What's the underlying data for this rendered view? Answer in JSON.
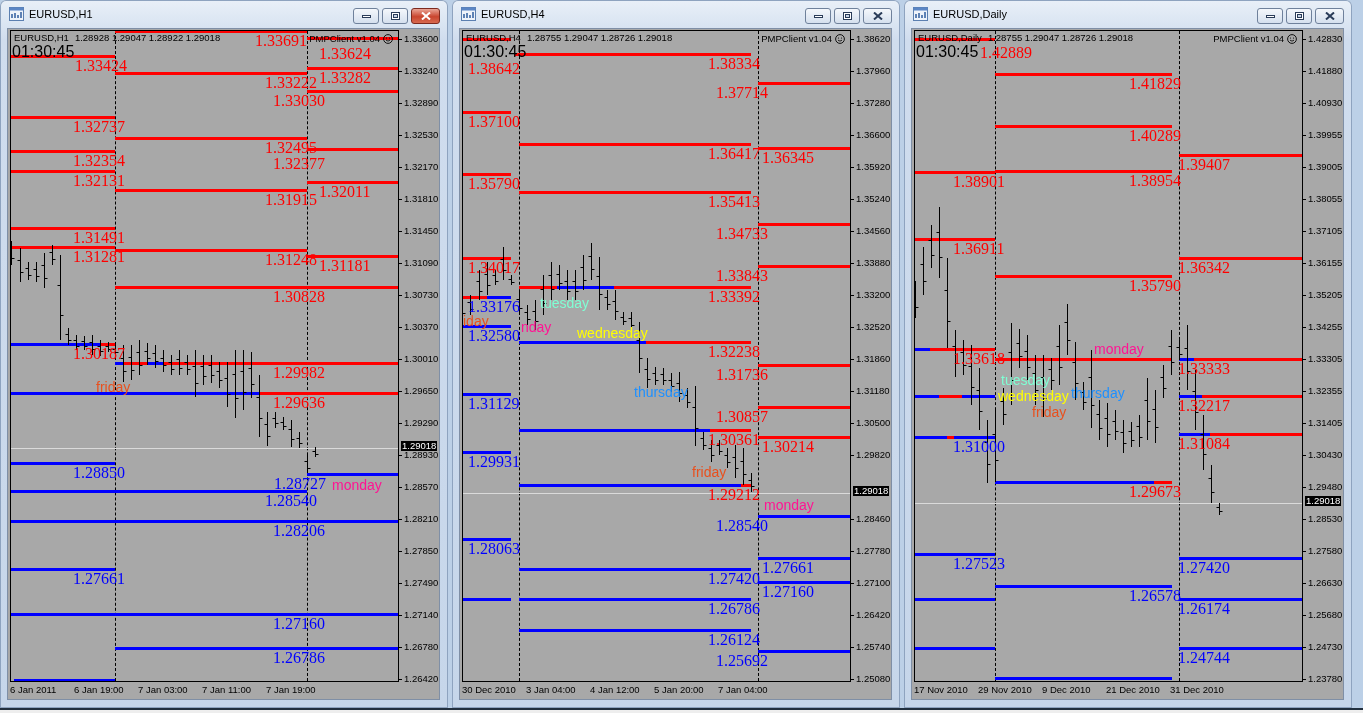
{
  "windows": [
    {
      "title": "EURUSD,H1",
      "active": true,
      "header": {
        "symbol": "EURUSD,H1",
        "prices": "1.28928 1.29047 1.28922 1.29018",
        "countdown": "01:30:45",
        "indicator": "PMPClient v1.04"
      },
      "price_axis": {
        "ticks": [
          "1.33600",
          "1.33240",
          "1.32890",
          "1.32530",
          "1.32170",
          "1.31810",
          "1.31450",
          "1.31090",
          "1.30730",
          "1.30370",
          "1.30010",
          "1.29650",
          "1.29290",
          "1.28930",
          "1.28570",
          "1.28210",
          "1.27850",
          "1.27490",
          "1.27140",
          "1.26780",
          "1.26420"
        ],
        "current": "1.29018"
      },
      "time_axis": [
        "6 Jan 2011",
        "6 Jan 19:00",
        "7 Jan 03:00",
        "7 Jan 11:00",
        "7 Jan 19:00"
      ],
      "levels": [
        {
          "label": "1.33691",
          "color": "#ff0000"
        },
        {
          "label": "1.33624",
          "color": "#ff0000"
        },
        {
          "label": "1.33424",
          "color": "#ff0000"
        },
        {
          "label": "1.33282",
          "color": "#ff0000"
        },
        {
          "label": "1.33222",
          "color": "#ff0000"
        },
        {
          "label": "1.33030",
          "color": "#ff0000"
        },
        {
          "label": "1.32737",
          "color": "#ff0000"
        },
        {
          "label": "1.32495",
          "color": "#ff0000"
        },
        {
          "label": "1.32377",
          "color": "#ff0000"
        },
        {
          "label": "1.32354",
          "color": "#ff0000"
        },
        {
          "label": "1.32131",
          "color": "#ff0000"
        },
        {
          "label": "1.32011",
          "color": "#ff0000"
        },
        {
          "label": "1.31915",
          "color": "#ff0000"
        },
        {
          "label": "1.31491",
          "color": "#ff0000"
        },
        {
          "label": "1.31281",
          "color": "#ff0000"
        },
        {
          "label": "1.31248",
          "color": "#ff0000"
        },
        {
          "label": "1.31181",
          "color": "#ff0000"
        },
        {
          "label": "1.30828",
          "color": "#ff0000"
        },
        {
          "label": "1.30187",
          "color": "#ff0000",
          "segments": [
            {
              "color": "#0000ff"
            },
            {
              "color": "#ff0000"
            }
          ]
        },
        {
          "label": "1.29982",
          "color": "#ff0000",
          "segments": [
            {
              "color": "#0000ff"
            },
            {
              "color": "#ff0000"
            },
            {
              "color": "#0000ff"
            },
            {
              "color": "#ff0000"
            }
          ]
        },
        {
          "label": "1.29636",
          "color": "#ff0000",
          "segments": [
            {
              "color": "#0000ff"
            },
            {
              "color": "#ff0000"
            }
          ]
        },
        {
          "label": "1.28850",
          "color": "#0000ff"
        },
        {
          "label": "1.28727",
          "color": "#0000ff"
        },
        {
          "label": "1.28540",
          "color": "#0000ff"
        },
        {
          "label": "1.28206",
          "color": "#0000ff"
        },
        {
          "label": "1.27661",
          "color": "#0000ff"
        },
        {
          "label": "1.27160",
          "color": "#0000ff"
        },
        {
          "label": "1.26786",
          "color": "#0000ff"
        },
        {
          "color": "#0000ff"
        }
      ],
      "day_labels": [
        {
          "label": "friday",
          "color": "#e8501e"
        },
        {
          "label": "monday",
          "color": "#ff1493"
        }
      ]
    },
    {
      "title": "EURUSD,H4",
      "active": false,
      "header": {
        "symbol": "EURUSD,H4",
        "prices": "1.28755 1.29047 1.28726 1.29018",
        "countdown": "01:30:45",
        "indicator": "PMPClient v1.04"
      },
      "price_axis": {
        "ticks": [
          "1.38620",
          "1.37960",
          "1.37280",
          "1.36600",
          "1.35920",
          "1.35240",
          "1.34560",
          "1.33880",
          "1.33200",
          "1.32520",
          "1.31860",
          "1.31180",
          "1.30500",
          "1.29820",
          "1.28460",
          "1.27780",
          "1.27100",
          "1.26420",
          "1.25740",
          "1.25080"
        ],
        "current": "1.29018"
      },
      "time_axis": [
        "30 Dec 2010",
        "3 Jan 04:00",
        "4 Jan 12:00",
        "5 Jan 20:00",
        "7 Jan 04:00"
      ],
      "levels": [
        {
          "label": "1.38642",
          "color": "#ff0000"
        },
        {
          "label": "1.38334",
          "color": "#ff0000"
        },
        {
          "label": "1.37714",
          "color": "#ff0000"
        },
        {
          "label": "1.37100",
          "color": "#ff0000"
        },
        {
          "label": "1.36417",
          "color": "#ff0000"
        },
        {
          "label": "1.36345",
          "color": "#ff0000"
        },
        {
          "label": "1.35790",
          "color": "#ff0000"
        },
        {
          "label": "1.35413",
          "color": "#ff0000"
        },
        {
          "label": "1.34733",
          "color": "#ff0000"
        },
        {
          "label": "1.34017",
          "color": "#ff0000"
        },
        {
          "label": "1.33843",
          "color": "#ff0000"
        },
        {
          "label": "1.33392",
          "color": "#ff0000",
          "segments": [
            {
              "color": "#ff0000"
            },
            {
              "color": "#0000ff"
            },
            {
              "color": "#ff0000"
            }
          ]
        },
        {
          "label": "1.33176",
          "color": "#0000ff",
          "segments": [
            {
              "color": "#ff0000"
            },
            {
              "color": "#0000ff"
            }
          ]
        },
        {
          "label": "1.32580",
          "color": "#0000ff"
        },
        {
          "label": "1.32238",
          "color": "#ff0000",
          "segments": [
            {
              "color": "#0000ff"
            },
            {
              "color": "#ff0000"
            }
          ]
        },
        {
          "label": "1.31736",
          "color": "#ff0000"
        },
        {
          "label": "1.31129",
          "color": "#0000ff"
        },
        {
          "label": "1.30857",
          "color": "#ff0000"
        },
        {
          "label": "1.30361",
          "color": "#ff0000",
          "segments": [
            {
              "color": "#0000ff"
            },
            {
              "color": "#ff0000"
            }
          ]
        },
        {
          "label": "1.30214",
          "color": "#ff0000"
        },
        {
          "label": "1.29931",
          "color": "#0000ff"
        },
        {
          "label": "1.29212",
          "color": "#ff0000",
          "segments": [
            {
              "color": "#0000ff"
            },
            {
              "color": "#ff0000"
            }
          ]
        },
        {
          "label": "1.28540",
          "color": "#0000ff"
        },
        {
          "label": "1.28063",
          "color": "#0000ff"
        },
        {
          "label": "1.27661",
          "color": "#0000ff"
        },
        {
          "label": "1.27420",
          "color": "#0000ff"
        },
        {
          "label": "1.27160",
          "color": "#0000ff"
        },
        {
          "color": "#0000ff"
        },
        {
          "label": "1.26786",
          "color": "#0000ff"
        },
        {
          "label": "1.26124",
          "color": "#0000ff"
        },
        {
          "label": "1.25692",
          "color": "#0000ff"
        }
      ],
      "day_labels": [
        {
          "label": "tuesday",
          "color": "#7fffd4"
        },
        {
          "label": "iday",
          "color": "#e8501e"
        },
        {
          "label": "nday",
          "color": "#ff1493"
        },
        {
          "label": "wednesday",
          "color": "#ffff00"
        },
        {
          "label": "thursday",
          "color": "#1e90ff"
        },
        {
          "label": "friday",
          "color": "#e8501e"
        },
        {
          "label": "monday",
          "color": "#ff1493"
        }
      ]
    },
    {
      "title": "EURUSD,Daily",
      "active": false,
      "header": {
        "symbol": "EURUSD,Daily",
        "prices": "1.28755 1.29047 1.28726 1.29018",
        "countdown": "01:30:45",
        "indicator": "PMPClient v1.04"
      },
      "price_axis": {
        "ticks": [
          "1.42830",
          "1.41880",
          "1.40930",
          "1.39955",
          "1.39005",
          "1.38055",
          "1.37105",
          "1.36155",
          "1.35205",
          "1.34255",
          "1.33305",
          "1.32355",
          "1.31405",
          "1.30430",
          "1.29480",
          "1.28530",
          "1.27580",
          "1.26630",
          "1.25680",
          "1.24730",
          "1.23780"
        ],
        "current": "1.29018"
      },
      "time_axis": [
        "17 Nov 2010",
        "29 Nov 2010",
        "9 Dec 2010",
        "21 Dec 2010",
        "31 Dec 2010"
      ],
      "levels": [
        {
          "label": "1.42889",
          "color": "#ff0000"
        },
        {
          "label": "1.41829",
          "color": "#ff0000"
        },
        {
          "label": "1.40289",
          "color": "#ff0000"
        },
        {
          "label": "1.39407",
          "color": "#ff0000"
        },
        {
          "label": "1.38954",
          "color": "#ff0000"
        },
        {
          "label": "1.38901",
          "color": "#ff0000"
        },
        {
          "label": "1.36911",
          "color": "#ff0000"
        },
        {
          "label": "1.36342",
          "color": "#ff0000"
        },
        {
          "label": "1.35790",
          "color": "#ff0000"
        },
        {
          "label": "1.33618",
          "color": "#ff0000",
          "segments": [
            {
              "color": "#0000ff"
            },
            {
              "color": "#ff0000"
            }
          ]
        },
        {
          "color": "#ff0000"
        },
        {
          "label": "1.33333",
          "color": "#ff0000",
          "segments": [
            {
              "color": "#0000ff"
            },
            {
              "color": "#ff0000"
            }
          ]
        },
        {
          "segments": [
            {
              "color": "#0000ff"
            },
            {
              "color": "#ff0000"
            },
            {
              "color": "#0000ff"
            }
          ]
        },
        {
          "label": "1.32217",
          "color": "#ff0000",
          "segments": [
            {
              "color": "#0000ff"
            },
            {
              "color": "#ff0000"
            }
          ]
        },
        {
          "label": "1.31084",
          "color": "#ff0000",
          "segments": [
            {
              "color": "#0000ff"
            },
            {
              "color": "#ff0000"
            }
          ]
        },
        {
          "label": "1.31000",
          "color": "#0000ff",
          "segments": [
            {
              "color": "#0000ff"
            },
            {
              "color": "#ff0000"
            },
            {
              "color": "#0000ff"
            }
          ]
        },
        {
          "label": "1.29673",
          "color": "#ff0000",
          "segments": [
            {
              "color": "#0000ff"
            },
            {
              "color": "#ff0000"
            }
          ]
        },
        {
          "label": "1.27523",
          "color": "#0000ff"
        },
        {
          "label": "1.27420",
          "color": "#0000ff"
        },
        {
          "label": "1.26578",
          "color": "#0000ff"
        },
        {
          "color": "#0000ff"
        },
        {
          "label": "1.26174",
          "color": "#0000ff"
        },
        {
          "color": "#0000ff"
        },
        {
          "label": "1.24744",
          "color": "#0000ff"
        },
        {
          "color": "#0000ff"
        }
      ],
      "day_labels": [
        {
          "label": "monday",
          "color": "#ff1493"
        },
        {
          "label": "tuesday",
          "color": "#7fffd4"
        },
        {
          "label": "wednesday",
          "color": "#ffff00"
        },
        {
          "label": "thursday",
          "color": "#1e90ff"
        },
        {
          "label": "friday",
          "color": "#e8501e"
        }
      ]
    }
  ]
}
